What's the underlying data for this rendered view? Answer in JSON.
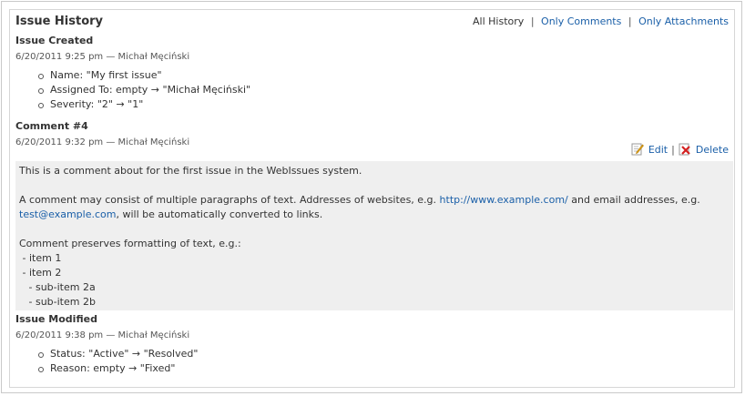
{
  "header": {
    "title": "Issue History",
    "filter_all": "All History",
    "filter_comments": "Only Comments",
    "filter_attachments": "Only Attachments",
    "separator": "|"
  },
  "events": {
    "created": {
      "title": "Issue Created",
      "meta": "6/20/2011 9:25 pm — Michał Męciński",
      "changes": [
        "Name: \"My first issue\"",
        "Assigned To: empty → \"Michał Męciński\"",
        "Severity: \"2\" → \"1\""
      ]
    },
    "comment": {
      "title": "Comment #4",
      "meta": "6/20/2011 9:32 pm — Michał Męciński",
      "edit_label": "Edit",
      "delete_label": "Delete",
      "separator": "|",
      "text_line1": "This is a comment about for the first issue in the WebIssues system.",
      "text_p2_before": "A comment may consist of multiple paragraphs of text. Addresses of websites, e.g. ",
      "link_url": "http://www.example.com/",
      "text_p2_middle": " and email addresses, e.g. ",
      "link_email": "test@example.com",
      "text_p2_after": ", will be automatically converted to links.",
      "text_p3": "Comment preserves formatting of text, e.g.:\n - item 1\n - item 2\n   - sub-item 2a\n   - sub-item 2b"
    },
    "modified": {
      "title": "Issue Modified",
      "meta": "6/20/2011 9:38 pm — Michał Męciński",
      "changes": [
        "Status: \"Active\" → \"Resolved\"",
        "Reason: empty → \"Fixed\""
      ]
    }
  },
  "icons": {
    "edit": "pencil-edit-icon",
    "delete": "red-x-delete-icon"
  },
  "colors": {
    "link": "#1a5fa8",
    "comment_bg": "#efefef",
    "delete_icon": "#d42020"
  }
}
